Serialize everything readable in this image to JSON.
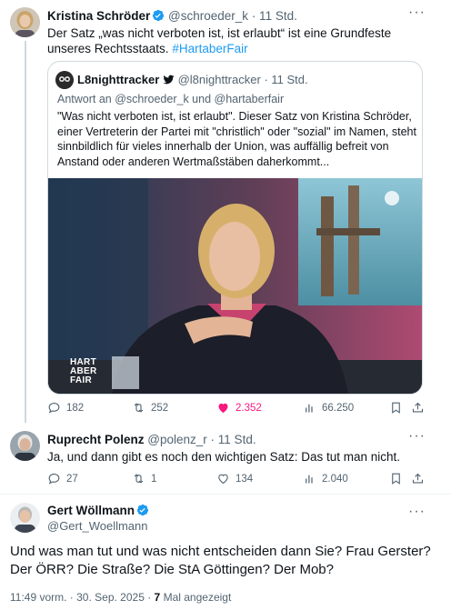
{
  "tweet1": {
    "name": "Kristina Schröder",
    "handle": "@schroeder_k",
    "time": "· 11 Std.",
    "text": "Der Satz „was nicht verboten ist, ist erlaubt“ ist eine Grundfeste unseres Rechtsstaats.",
    "hashtag": "#HartaberFair",
    "actions": {
      "replies": "182",
      "reposts": "252",
      "likes": "2.352",
      "views": "66.250"
    },
    "like_color": "#f91880"
  },
  "quote": {
    "name": "L8nighttracker",
    "handle": "@l8nighttracker",
    "time": "· 11 Std.",
    "reply_to": "Antwort an @schroeder_k und @hartaberfair",
    "text": "\"Was nicht verboten ist, ist erlaubt\". Dieser Satz von Kristina Schröder, einer Vertreterin der Partei mit \"christlich\" oder \"sozial\" im Namen, steht sinnbildlich für vieles innerhalb der Union, was auffällig befreit von Anstand oder anderen Wertmaßstäben daherkommt...",
    "video_logo": "HART ABER FAIR"
  },
  "tweet2": {
    "name": "Ruprecht Polenz",
    "handle": "@polenz_r",
    "time": "· 11 Std.",
    "text": "Ja, und dann gibt es noch den wichtigen Satz: Das tut man nicht.",
    "actions": {
      "replies": "27",
      "reposts": "1",
      "likes": "134",
      "views": "2.040"
    }
  },
  "tweet3": {
    "name": "Gert Wöllmann",
    "handle": "@Gert_Woellmann",
    "text": "Und was man tut und was nicht entscheiden dann Sie? Frau Gerster? Der ÖRR? Die Straße? Die StA Göttingen? Der Mob?",
    "timestamp": "11:49 vorm. · 30. Sep. 2025 ·",
    "views_count": "7",
    "views_label": "Mal angezeigt"
  },
  "colors": {
    "accent": "#1d9bf0",
    "verified": "#1d9bf0",
    "text": "#0f1419",
    "muted": "#536471"
  }
}
